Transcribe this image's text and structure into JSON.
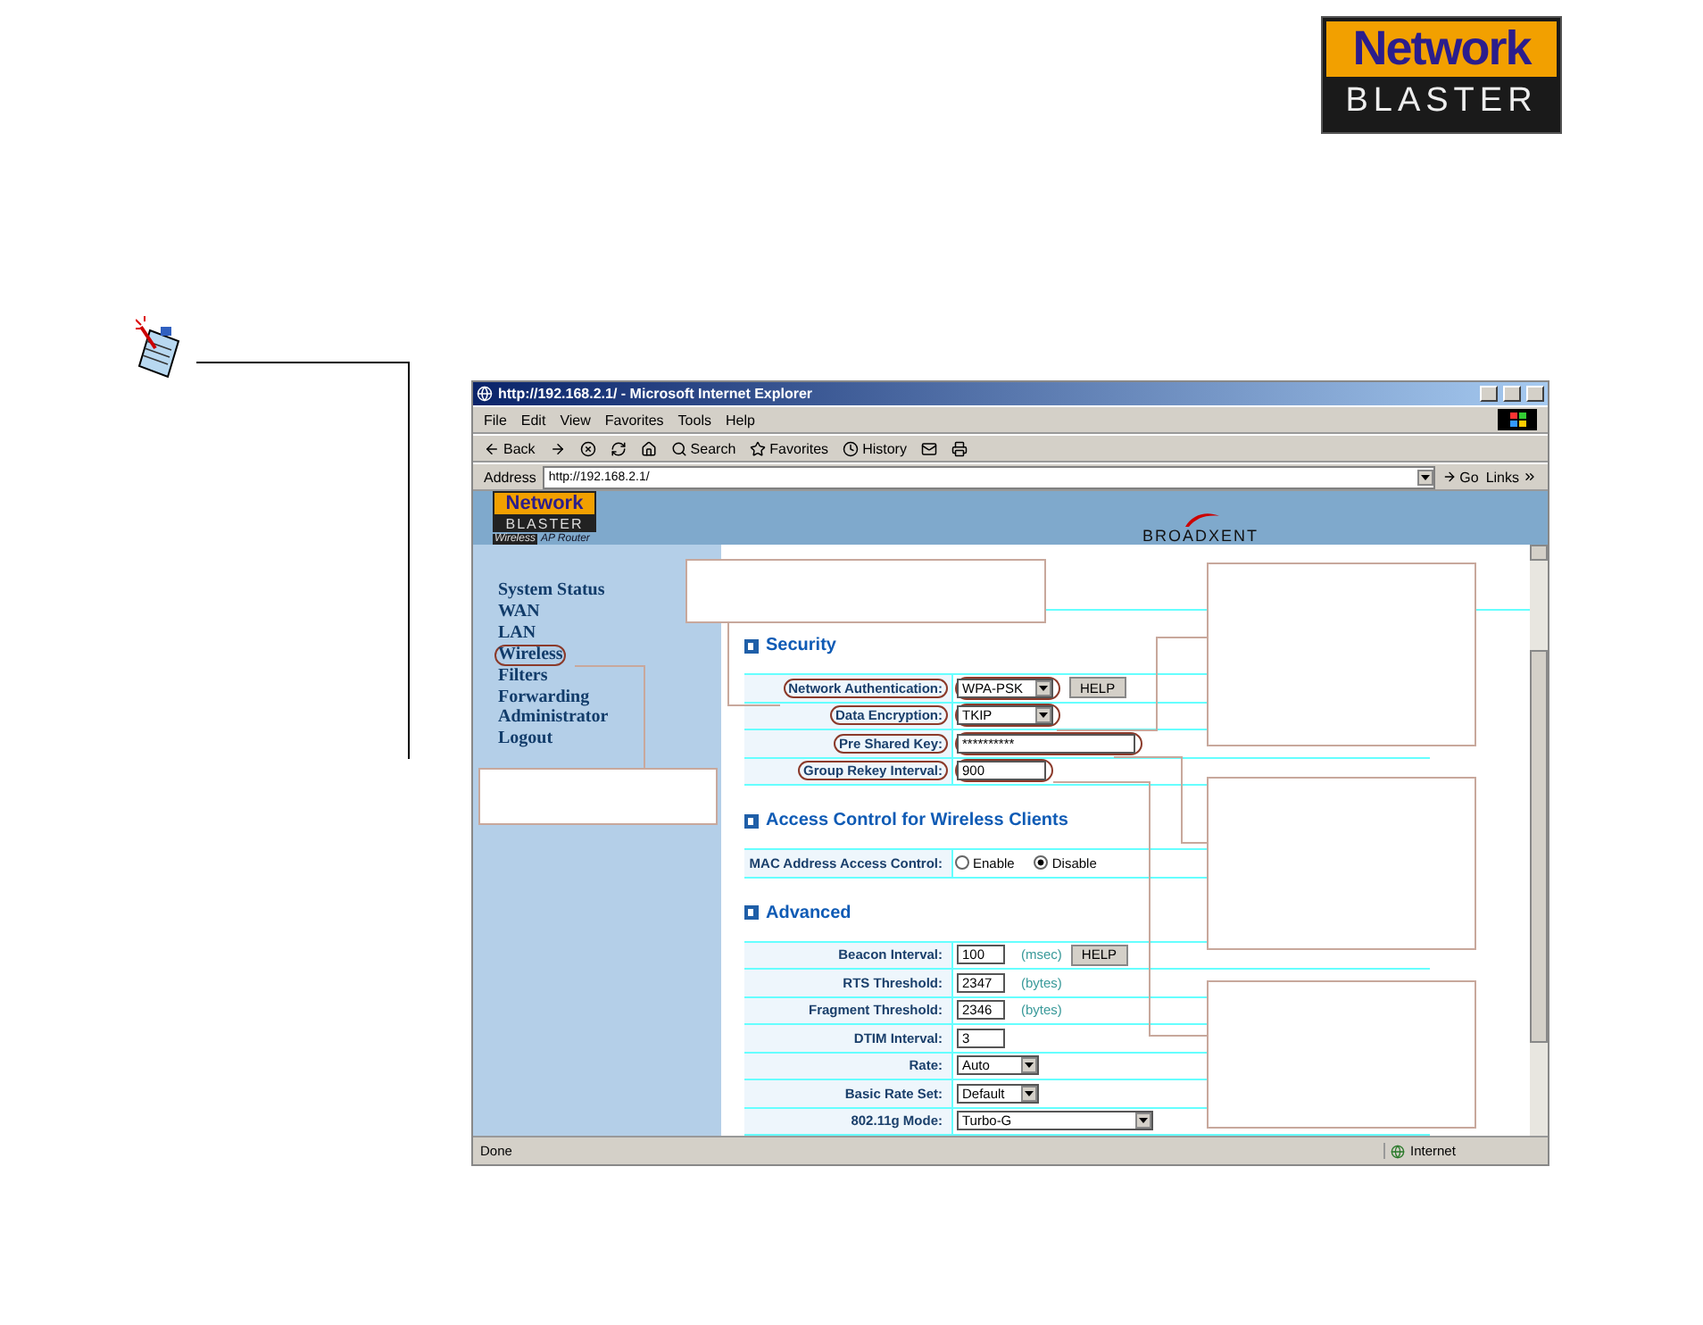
{
  "logo": {
    "top": "Network",
    "bottom": "BLASTER"
  },
  "browser": {
    "title": "http://192.168.2.1/ - Microsoft Internet Explorer",
    "menu": [
      "File",
      "Edit",
      "View",
      "Favorites",
      "Tools",
      "Help"
    ],
    "toolbar": [
      {
        "kind": "back",
        "label": "Back"
      },
      {
        "kind": "forward"
      },
      {
        "kind": "stop"
      },
      {
        "kind": "refresh"
      },
      {
        "kind": "home"
      },
      {
        "kind": "search",
        "label": "Search"
      },
      {
        "kind": "favorites",
        "label": "Favorites"
      },
      {
        "kind": "history",
        "label": "History"
      },
      {
        "kind": "mail"
      },
      {
        "kind": "print"
      }
    ],
    "address": {
      "label": "Address",
      "value": "http://192.168.2.1/"
    },
    "go": "Go",
    "links": "Links",
    "status": {
      "text": "Done",
      "zone": "Internet"
    }
  },
  "router": {
    "logo_top": "Network",
    "logo_bottom": "BLASTER",
    "logo_tag": "Wireless",
    "logo_sub": "AP Router",
    "brand": "BROADXENT",
    "nav": [
      {
        "label": "System Status",
        "circled": false
      },
      {
        "label": "WAN",
        "circled": false
      },
      {
        "label": "LAN",
        "circled": false
      },
      {
        "label": "Wireless",
        "circled": true
      },
      {
        "label": "Filters",
        "circled": false
      },
      {
        "label": "Forwarding",
        "circled": false
      },
      {
        "label": "Administrator",
        "circled": false
      },
      {
        "label": "Logout",
        "circled": false
      }
    ],
    "sections": [
      {
        "title": "Security",
        "rows": [
          {
            "label": "Network Authentication:",
            "kind": "select",
            "value": "WPA-PSK",
            "circled": true,
            "help": "HELP"
          },
          {
            "label": "Data Encryption:",
            "kind": "select",
            "value": "TKIP",
            "circled": true
          },
          {
            "label": "Pre Shared Key:",
            "kind": "input",
            "value": "**********",
            "circled": true
          },
          {
            "label": "Group Rekey Interval:",
            "kind": "input",
            "value": "900",
            "circled": true
          }
        ]
      },
      {
        "title": "Access Control for Wireless Clients",
        "rows": [
          {
            "label": "MAC Address Access Control:",
            "kind": "radio",
            "circled": false,
            "options": [
              {
                "label": "Enable",
                "selected": false
              },
              {
                "label": "Disable",
                "selected": true
              }
            ]
          }
        ]
      },
      {
        "title": "Advanced",
        "rows": [
          {
            "label": "Beacon Interval:",
            "kind": "input",
            "value": "100",
            "unit": "(msec)",
            "circled": false,
            "help": "HELP"
          },
          {
            "label": "RTS Threshold:",
            "kind": "input",
            "value": "2347",
            "unit": "(bytes)",
            "circled": false
          },
          {
            "label": "Fragment Threshold:",
            "kind": "input",
            "value": "2346",
            "unit": "(bytes)",
            "circled": false
          },
          {
            "label": "DTIM Interval:",
            "kind": "input",
            "value": "3",
            "circled": false
          },
          {
            "label": "Rate:",
            "kind": "select",
            "value": "Auto",
            "circled": false
          },
          {
            "label": "Basic Rate Set:",
            "kind": "select",
            "value": "Default",
            "circled": false
          },
          {
            "label": "802.11g Mode:",
            "kind": "select",
            "value": "Turbo-G",
            "wide": true,
            "circled": false
          }
        ]
      }
    ]
  }
}
